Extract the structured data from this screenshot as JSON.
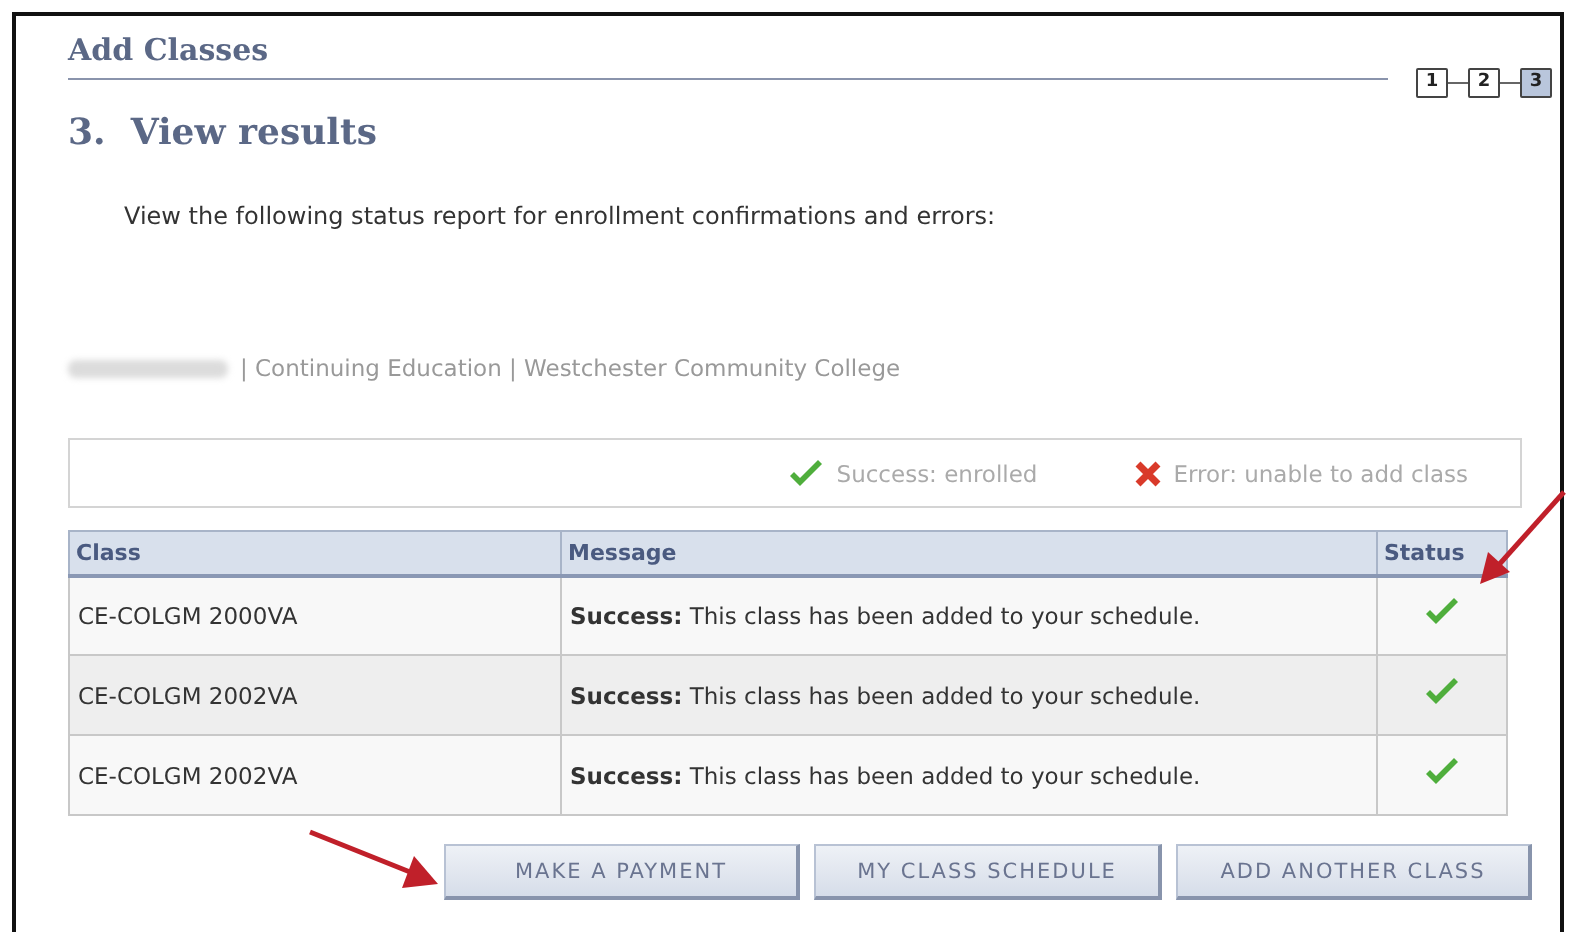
{
  "section_title": "Add Classes",
  "steps": [
    {
      "label": "1",
      "selected": false
    },
    {
      "label": "2",
      "selected": false
    },
    {
      "label": "3",
      "selected": true
    }
  ],
  "step_title": "3.  View results",
  "instructions": "View the following status report for enrollment confirmations and errors:",
  "term_line": "| Continuing Education | Westchester Community College",
  "legend": [
    {
      "kind": "success",
      "label": "Success: enrolled"
    },
    {
      "kind": "error",
      "label": "Error: unable to add class"
    }
  ],
  "table": {
    "columns": [
      "Class",
      "Message",
      "Status"
    ],
    "rows": [
      {
        "class": "CE-COLGM 2000VA",
        "message": "**Success:** This class has been added to your schedule.",
        "kind": "success"
      },
      {
        "class": "CE-COLGM 2002VA",
        "message": "**Success:** This class has been added to your schedule.",
        "kind": "success"
      },
      {
        "class": "CE-COLGM 2002VA",
        "message": "**Success:** This class has been added to your schedule.",
        "kind": "success"
      }
    ]
  },
  "buttons": [
    "MAKE A PAYMENT",
    "MY CLASS SCHEDULE",
    "ADD ANOTHER CLASS"
  ]
}
